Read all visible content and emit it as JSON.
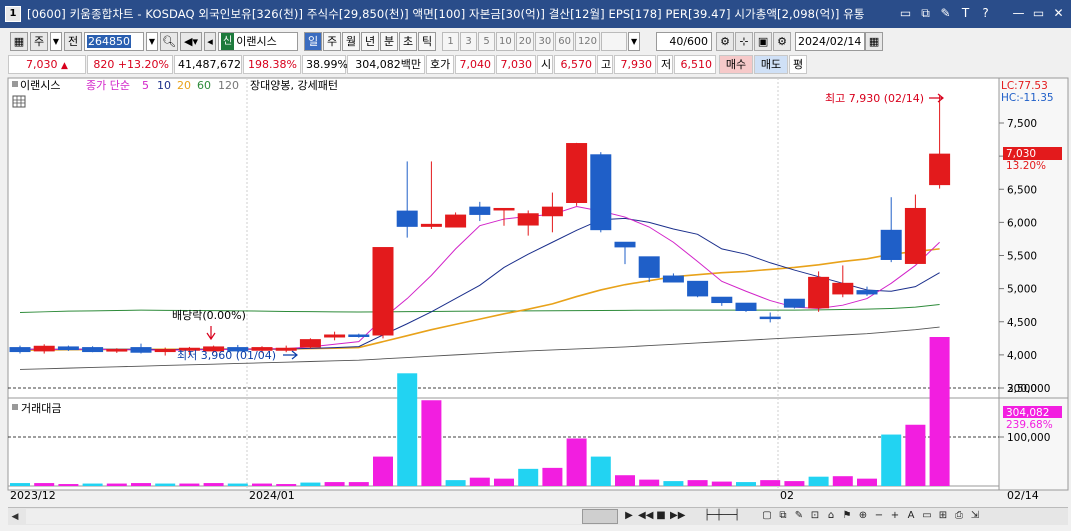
{
  "window": {
    "app_number": "1",
    "title": "[0600] 키움종합차트 - KOSDAQ 외국인보유[326(천)] 주식수[29,850(천)] 액면[100] 자본금[30(억)] 결산[12월] EPS[178] PER[39.47] 시가총액[2,098(억)] 유통",
    "buttons": [
      "▭",
      "⧉",
      "✎",
      "T",
      "?",
      "—",
      "▭",
      "✕"
    ]
  },
  "toolbar": {
    "type": "주",
    "scope": "전",
    "code": "264850",
    "stock_name": "이랜시스",
    "stock_badge": "신",
    "periods": [
      "일",
      "주",
      "월",
      "년",
      "분",
      "초",
      "틱"
    ],
    "active_period": "일",
    "numbers": [
      "1",
      "3",
      "5",
      "10",
      "20",
      "30",
      "60",
      "120"
    ],
    "count": "40/600",
    "date": "2024/02/14"
  },
  "quote": {
    "price": "7,030",
    "arrow": "▲",
    "change": "820",
    "change_pct": "+13.20%",
    "volume": "41,487,672",
    "vol_ratio": "198.38%",
    "turnover": "38.99%",
    "amount": "304,082백만",
    "ask_label": "호가",
    "ask1": "7,040",
    "ask2": "7,030",
    "open_label": "시",
    "open": "6,570",
    "high_label": "고",
    "high": "7,930",
    "low_label": "저",
    "low": "6,510",
    "buy": "매수",
    "sell": "매도",
    "eval": "평"
  },
  "legend": {
    "name": "이랜시스",
    "ma_label": "종가 단순",
    "ma_periods": [
      "5",
      "10",
      "20",
      "60",
      "120"
    ],
    "pattern": "장대양봉, 강세패턴",
    "lc": "LC:77.53",
    "hc": "HC:-11.35",
    "vol_title": "거래대금"
  },
  "annotations": {
    "high": "최고 7,930 (02/14)",
    "low": "최저 3,960 (01/04)",
    "dividend": "배당락(0.00%)"
  },
  "colors": {
    "up": "#e31a1c",
    "down": "#1f5fc8",
    "ma5": "#d223c9",
    "ma10": "#1b2f8c",
    "ma20": "#e8a21a",
    "ma60": "#2e8b3a",
    "ma120": "#555555",
    "vol_cyan": "#22d3f2",
    "vol_magenta": "#f21ee0"
  },
  "chart_data": {
    "type": "candlestick",
    "price_ticks": [
      "7,500",
      "7,000",
      "6,500",
      "6,000",
      "5,500",
      "5,000",
      "4,500",
      "4,000",
      "3,500"
    ],
    "price_tick_values": [
      7500,
      7000,
      6500,
      6000,
      5500,
      5000,
      4500,
      4000,
      3500
    ],
    "last_price_tag": "7,030",
    "last_pct_tag": "13.20%",
    "vol_ticks": [
      "200,000",
      "100,000"
    ],
    "vol_tick_values": [
      200000,
      100000
    ],
    "vol_last_tag": "304,082",
    "vol_last_pct": "239.68%",
    "x_labels": [
      "2023/12",
      "2024/01",
      "02",
      "02/14"
    ],
    "candles": [
      {
        "o": 4110,
        "h": 4140,
        "l": 4020,
        "c": 4050
      },
      {
        "o": 4060,
        "h": 4160,
        "l": 4020,
        "c": 4130
      },
      {
        "o": 4120,
        "h": 4140,
        "l": 4060,
        "c": 4080
      },
      {
        "o": 4110,
        "h": 4130,
        "l": 4040,
        "c": 4050
      },
      {
        "o": 4070,
        "h": 4100,
        "l": 4030,
        "c": 4080
      },
      {
        "o": 4110,
        "h": 4170,
        "l": 4020,
        "c": 4040
      },
      {
        "o": 4050,
        "h": 4110,
        "l": 3990,
        "c": 4080
      },
      {
        "o": 4070,
        "h": 4120,
        "l": 4000,
        "c": 4100
      },
      {
        "o": 4060,
        "h": 4140,
        "l": 4030,
        "c": 4120
      },
      {
        "o": 4110,
        "h": 4150,
        "l": 4030,
        "c": 4060
      },
      {
        "o": 4070,
        "h": 4130,
        "l": 4030,
        "c": 4110
      },
      {
        "o": 4070,
        "h": 4140,
        "l": 4040,
        "c": 4100
      },
      {
        "o": 4120,
        "h": 4250,
        "l": 4100,
        "c": 4230
      },
      {
        "o": 4270,
        "h": 4350,
        "l": 4220,
        "c": 4300
      },
      {
        "o": 4300,
        "h": 4320,
        "l": 4260,
        "c": 4280
      },
      {
        "o": 4300,
        "h": 5620,
        "l": 4250,
        "c": 5620
      },
      {
        "o": 6170,
        "h": 6920,
        "l": 5770,
        "c": 5940
      },
      {
        "o": 5940,
        "h": 6920,
        "l": 5900,
        "c": 5970
      },
      {
        "o": 5930,
        "h": 6150,
        "l": 5930,
        "c": 6110
      },
      {
        "o": 6230,
        "h": 6310,
        "l": 6020,
        "c": 6120
      },
      {
        "o": 6200,
        "h": 6200,
        "l": 5950,
        "c": 6210
      },
      {
        "o": 5960,
        "h": 6180,
        "l": 5800,
        "c": 6130
      },
      {
        "o": 6100,
        "h": 6450,
        "l": 5850,
        "c": 6230
      },
      {
        "o": 6300,
        "h": 7200,
        "l": 6250,
        "c": 7190
      },
      {
        "o": 7020,
        "h": 7060,
        "l": 5850,
        "c": 5890
      },
      {
        "o": 5700,
        "h": 5700,
        "l": 5370,
        "c": 5630
      },
      {
        "o": 5480,
        "h": 5480,
        "l": 5100,
        "c": 5170
      },
      {
        "o": 5190,
        "h": 5230,
        "l": 5100,
        "c": 5100
      },
      {
        "o": 5110,
        "h": 5110,
        "l": 4870,
        "c": 4890
      },
      {
        "o": 4870,
        "h": 4870,
        "l": 4740,
        "c": 4790
      },
      {
        "o": 4780,
        "h": 4780,
        "l": 4650,
        "c": 4670
      },
      {
        "o": 4570,
        "h": 4640,
        "l": 4490,
        "c": 4560
      },
      {
        "o": 4840,
        "h": 4840,
        "l": 4700,
        "c": 4720
      },
      {
        "o": 4710,
        "h": 5260,
        "l": 4650,
        "c": 5170
      },
      {
        "o": 4920,
        "h": 5350,
        "l": 4870,
        "c": 5080
      },
      {
        "o": 4970,
        "h": 5030,
        "l": 4890,
        "c": 4920
      },
      {
        "o": 5880,
        "h": 6380,
        "l": 5400,
        "c": 5440
      },
      {
        "o": 5380,
        "h": 6420,
        "l": 5370,
        "c": 6210
      },
      {
        "o": 6570,
        "h": 7930,
        "l": 6510,
        "c": 7030
      }
    ],
    "volume": [
      6000,
      6000,
      4000,
      5000,
      5000,
      6000,
      5000,
      5000,
      6000,
      5000,
      5000,
      4000,
      7000,
      8000,
      8000,
      60000,
      230000,
      175000,
      12000,
      17000,
      15000,
      35000,
      37000,
      97000,
      60000,
      22000,
      13000,
      10000,
      12000,
      9000,
      8000,
      12000,
      10000,
      19000,
      20000,
      15000,
      105000,
      125000,
      304082
    ],
    "ma5": [
      4090,
      4080,
      4085,
      4085,
      4080,
      4075,
      4070,
      4075,
      4080,
      4085,
      4090,
      4095,
      4120,
      4160,
      4200,
      4550,
      4850,
      5200,
      5600,
      5950,
      6050,
      6090,
      6120,
      6240,
      6170,
      6080,
      5930,
      5700,
      5410,
      5110,
      4960,
      4820,
      4720,
      4700,
      4750,
      4850,
      5080,
      5350,
      5700
    ],
    "ma10": [
      4085,
      4085,
      4085,
      4085,
      4085,
      4083,
      4082,
      4083,
      4084,
      4085,
      4087,
      4088,
      4098,
      4110,
      4125,
      4300,
      4470,
      4650,
      4850,
      5050,
      5320,
      5520,
      5700,
      5880,
      6040,
      6060,
      6000,
      5900,
      5820,
      5600,
      5520,
      5390,
      5280,
      5180,
      5080,
      4980,
      4960,
      5030,
      5240
    ],
    "ma20": [
      4070,
      4075,
      4078,
      4080,
      4082,
      4083,
      4084,
      4085,
      4086,
      4087,
      4088,
      4089,
      4095,
      4100,
      4110,
      4200,
      4290,
      4380,
      4460,
      4540,
      4620,
      4690,
      4770,
      4880,
      4980,
      5060,
      5120,
      5180,
      5210,
      5240,
      5260,
      5290,
      5320,
      5360,
      5410,
      5450,
      5520,
      5560,
      5600
    ],
    "ma60": [
      4640,
      4650,
      4660,
      4665,
      4670,
      4675,
      4672,
      4670,
      4668,
      4665,
      4660,
      4655,
      4652,
      4650,
      4648,
      4650,
      4652,
      4655,
      4658,
      4660,
      4662,
      4664,
      4666,
      4668,
      4670,
      4672,
      4674,
      4676,
      4676,
      4676,
      4675,
      4675,
      4676,
      4680,
      4684,
      4690,
      4700,
      4720,
      4760
    ],
    "ma120": [
      3780,
      3790,
      3800,
      3810,
      3820,
      3830,
      3840,
      3850,
      3860,
      3870,
      3880,
      3890,
      3900,
      3910,
      3920,
      3940,
      3960,
      3980,
      4000,
      4020,
      4040,
      4060,
      4075,
      4090,
      4105,
      4120,
      4140,
      4160,
      4180,
      4200,
      4220,
      4240,
      4260,
      4280,
      4300,
      4320,
      4350,
      4380,
      4420
    ]
  }
}
